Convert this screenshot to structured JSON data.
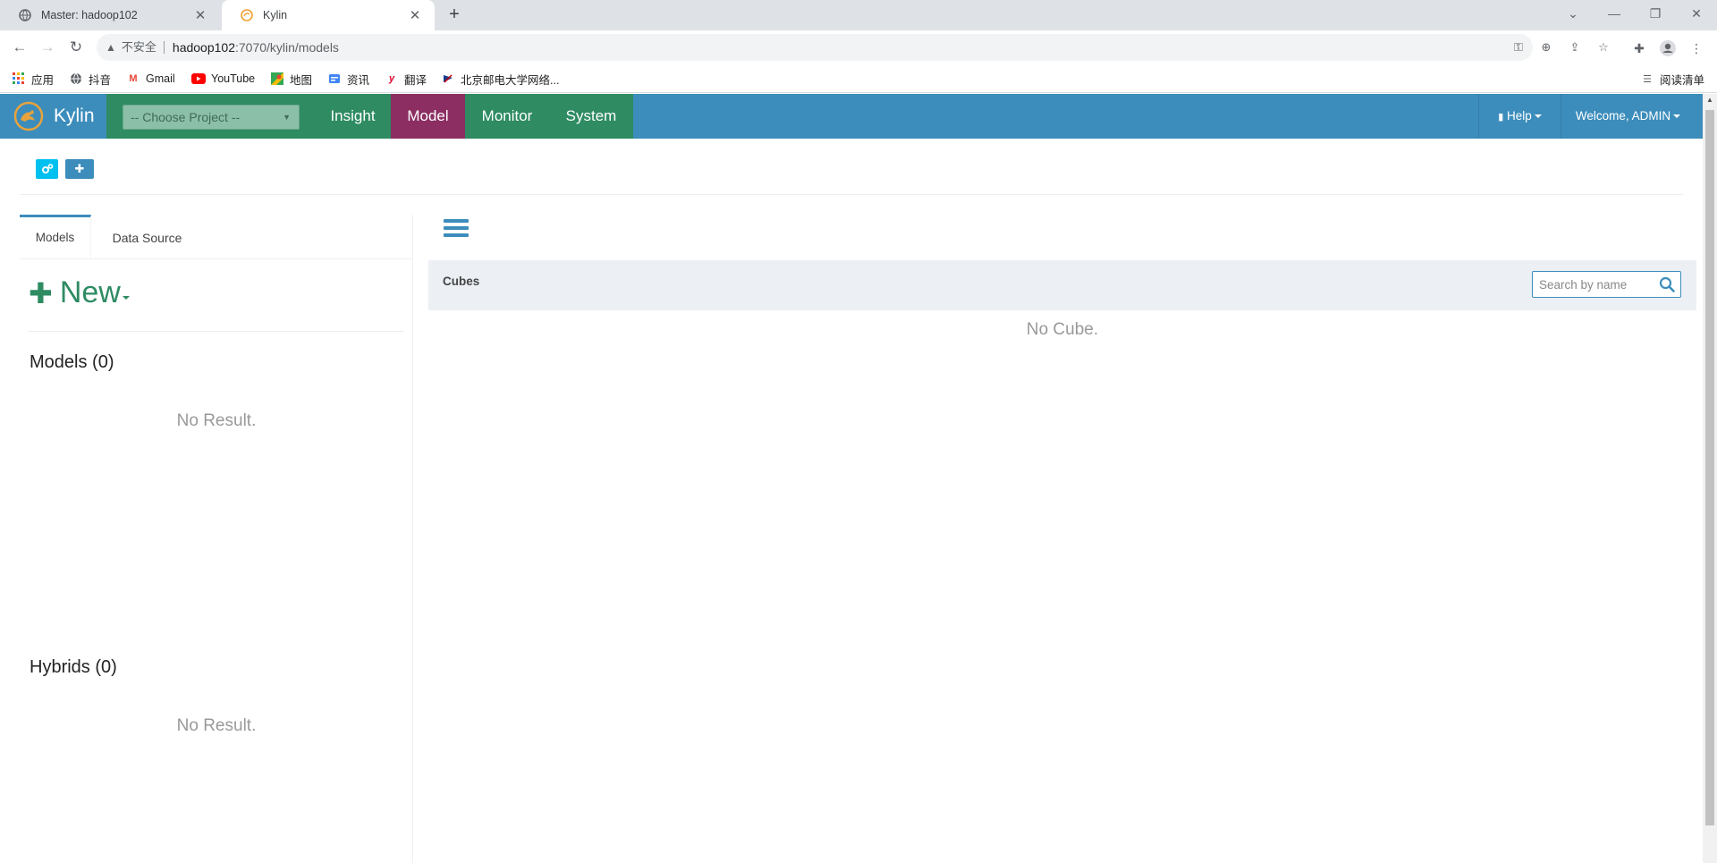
{
  "browser": {
    "tabs": [
      {
        "title": "Master: hadoop102"
      },
      {
        "title": "Kylin"
      }
    ],
    "address": {
      "security_label": "不安全",
      "host": "hadoop102",
      "path": ":7070/kylin/models"
    },
    "bookmarks": [
      {
        "label": "应用",
        "icon": "apps-grid-icon"
      },
      {
        "label": "抖音",
        "icon": "globe-icon"
      },
      {
        "label": "Gmail",
        "icon": "gmail-icon"
      },
      {
        "label": "YouTube",
        "icon": "youtube-icon"
      },
      {
        "label": "地图",
        "icon": "maps-icon"
      },
      {
        "label": "资讯",
        "icon": "news-icon"
      },
      {
        "label": "翻译",
        "icon": "translate-icon"
      },
      {
        "label": "北京邮电大学网络...",
        "icon": "bupt-icon"
      }
    ],
    "reading_list": "阅读清单"
  },
  "kylin": {
    "brand": "Kylin",
    "project_select": {
      "placeholder": "-- Choose Project --"
    },
    "menu": [
      {
        "label": "Insight",
        "color": "#2e8b62"
      },
      {
        "label": "Model",
        "color": "#8c2e62",
        "active": true
      },
      {
        "label": "Monitor",
        "color": "#2e8b62"
      },
      {
        "label": "System",
        "color": "#2e8b62"
      }
    ],
    "help": "Help",
    "welcome": "Welcome, ADMIN",
    "left": {
      "tabs": [
        {
          "label": "Models",
          "active": true
        },
        {
          "label": "Data Source"
        }
      ],
      "new_label": "New",
      "models_title": "Models (0)",
      "models_empty": "No Result.",
      "hybrids_title": "Hybrids (0)",
      "hybrids_empty": "No Result."
    },
    "cubes": {
      "title": "Cubes",
      "search_placeholder": "Search by name",
      "empty": "No Cube."
    },
    "colors": {
      "navbar": "#3c8dbc",
      "green": "#2e8b62",
      "model_active": "#8c2e62"
    }
  }
}
